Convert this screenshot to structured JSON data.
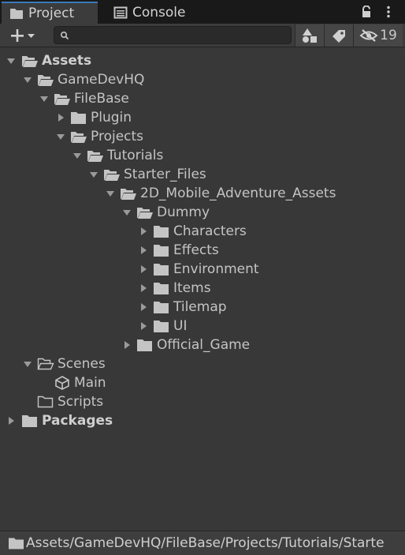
{
  "tabs": {
    "project": "Project",
    "console": "Console"
  },
  "toolbar": {
    "search_value": "",
    "hidden_count": "19"
  },
  "tree": {
    "assets": "Assets",
    "gamedevhq": "GameDevHQ",
    "filebase": "FileBase",
    "plugin": "Plugin",
    "projects": "Projects",
    "tutorials": "Tutorials",
    "starter_files": "Starter_Files",
    "mobile_assets": "2D_Mobile_Adventure_Assets",
    "dummy": "Dummy",
    "characters": "Characters",
    "effects": "Effects",
    "environment": "Environment",
    "items": "Items",
    "tilemap": "Tilemap",
    "ui": "UI",
    "official_game": "Official_Game",
    "scenes": "Scenes",
    "main": "Main",
    "scripts": "Scripts",
    "packages": "Packages"
  },
  "pathbar": {
    "path": "Assets/GameDevHQ/FileBase/Projects/Tutorials/Starte"
  },
  "icons": {
    "tab_project": "folder-icon",
    "tab_console": "console-icon",
    "lock": "lock-icon",
    "menu": "kebab-menu-icon",
    "create": "plus-icon",
    "search": "search-icon",
    "filter_type": "shapes-icon",
    "filter_label": "label-tag-icon",
    "hidden": "eye-slash-icon",
    "scene": "unity-logo-icon"
  },
  "colors": {
    "background": "#383838",
    "tab_strip": "#191919",
    "active_tab_accent": "#3a79bb",
    "text": "#c4c4c4"
  }
}
